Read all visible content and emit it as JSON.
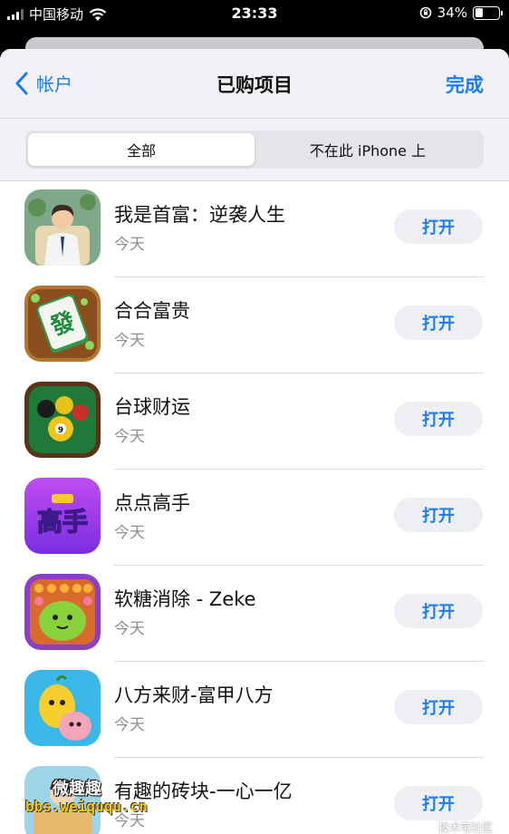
{
  "status_bar": {
    "carrier": "中国移动",
    "time": "23:33",
    "battery_percent": "34%",
    "battery_level": 0.34,
    "icons": [
      "signal-icon",
      "wifi-icon",
      "rotation-lock-icon",
      "battery-icon"
    ]
  },
  "nav": {
    "back_label": "帐户",
    "title": "已购项目",
    "done_label": "完成"
  },
  "segments": {
    "all_label": "全部",
    "not_on_device_label": "不在此 iPhone 上",
    "selected": "all"
  },
  "apps": [
    {
      "name": "我是首富：逆袭人生",
      "date": "今天",
      "button": "打开",
      "icon": "businessman-app-icon"
    },
    {
      "name": "合合富贵",
      "date": "今天",
      "button": "打开",
      "icon": "mahjong-app-icon"
    },
    {
      "name": "台球财运",
      "date": "今天",
      "button": "打开",
      "icon": "billiards-app-icon"
    },
    {
      "name": "点点高手",
      "date": "今天",
      "button": "打开",
      "icon": "gaoshou-app-icon"
    },
    {
      "name": "软糖消除 - Zeke",
      "date": "今天",
      "button": "打开",
      "icon": "candy-app-icon"
    },
    {
      "name": "八方来财-富甲八方",
      "date": "今天",
      "button": "打开",
      "icon": "cartoon-app-icon"
    },
    {
      "name": "有趣的砖块-一心一亿",
      "date": "今天",
      "button": "打开",
      "icon": "bricks-app-icon"
    }
  ],
  "watermark": {
    "line1": "微趣趣",
    "line2": "bbs.weiququ.cn",
    "corner": "技术宅社区"
  },
  "colors": {
    "accent": "#1b7cf6",
    "background": "#f2f2f6",
    "secondary_text": "#8e8e93"
  }
}
